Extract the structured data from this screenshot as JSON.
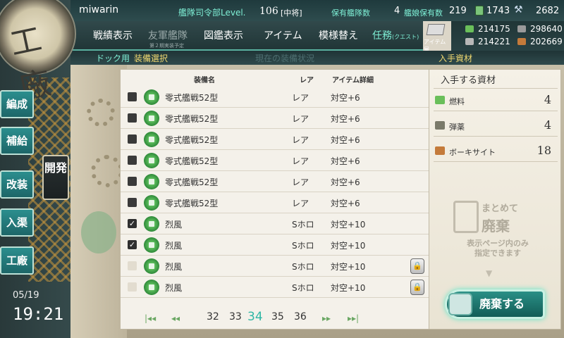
{
  "header": {
    "admiral_name": "miwarin",
    "hq_level_label": "艦隊司令部Level.",
    "hq_level": "106",
    "rank": "[中将]",
    "ships_label": "保有艦隊数",
    "ships_value": "4",
    "shipgirls_label": "艦娘保有数",
    "shipgirls_value": "219",
    "buckets": "1743",
    "dev_materials": "2682"
  },
  "nav": {
    "record": "戦績表示",
    "friend_fleet": "友軍艦隊",
    "friend_fleet_sub": "第２期実装予定",
    "library": "図鑑表示",
    "items": "アイテム",
    "furniture": "模様替え",
    "quest": "任務",
    "quest_small": "(クエスト)",
    "item_shop": "アイテム屋"
  },
  "resources": {
    "fuel": "214175",
    "ammo": "298640",
    "steel": "214221",
    "bauxite": "202669"
  },
  "sidebar": {
    "formation": "編成",
    "supply": "補給",
    "remodel": "改装",
    "repair": "入渠",
    "arsenal": "工廠",
    "development": "開発",
    "date": "05/19",
    "time": "19:21",
    "emblem": "工廠"
  },
  "subheader": {
    "dock_use": "ドック用",
    "equip_select": "装備選択",
    "current_equip": "現在の装備状況",
    "obtained": "入手資材"
  },
  "list": {
    "col_name": "装備名",
    "col_rarity": "レア",
    "col_detail": "アイテム詳細",
    "rows": [
      {
        "name": "零式艦戦52型",
        "rarity": "レア",
        "detail": "対空+6",
        "checked": false,
        "disabled": false,
        "locked": false
      },
      {
        "name": "零式艦戦52型",
        "rarity": "レア",
        "detail": "対空+6",
        "checked": false,
        "disabled": false,
        "locked": false
      },
      {
        "name": "零式艦戦52型",
        "rarity": "レア",
        "detail": "対空+6",
        "checked": false,
        "disabled": false,
        "locked": false
      },
      {
        "name": "零式艦戦52型",
        "rarity": "レア",
        "detail": "対空+6",
        "checked": false,
        "disabled": false,
        "locked": false
      },
      {
        "name": "零式艦戦52型",
        "rarity": "レア",
        "detail": "対空+6",
        "checked": false,
        "disabled": false,
        "locked": false
      },
      {
        "name": "零式艦戦52型",
        "rarity": "レア",
        "detail": "対空+6",
        "checked": false,
        "disabled": false,
        "locked": false
      },
      {
        "name": "烈風",
        "rarity": "Sホロ",
        "detail": "対空+10",
        "checked": true,
        "disabled": false,
        "locked": false
      },
      {
        "name": "烈風",
        "rarity": "Sホロ",
        "detail": "対空+10",
        "checked": true,
        "disabled": false,
        "locked": false
      },
      {
        "name": "烈風",
        "rarity": "Sホロ",
        "detail": "対空+10",
        "checked": false,
        "disabled": true,
        "locked": true
      },
      {
        "name": "烈風",
        "rarity": "Sホロ",
        "detail": "対空+10",
        "checked": false,
        "disabled": true,
        "locked": true
      }
    ],
    "pages": [
      "32",
      "33",
      "34",
      "35",
      "36"
    ],
    "current_page": "34"
  },
  "obtain_panel": {
    "title": "入手する資材",
    "fuel_label": "燃料",
    "fuel_value": "4",
    "ammo_label": "弾薬",
    "ammo_value": "4",
    "bauxite_label": "ボーキサイト",
    "bauxite_value": "18",
    "bulk_line1": "まとめて",
    "bulk_line2": "廃棄",
    "bulk_line3": "表示ページ内のみ",
    "bulk_line4": "指定できます",
    "dispose_button": "廃棄する"
  },
  "colors": {
    "accent": "#2fb7a5",
    "header_bg": "#1f3a3d",
    "equip_icon": "#3a9a45"
  }
}
